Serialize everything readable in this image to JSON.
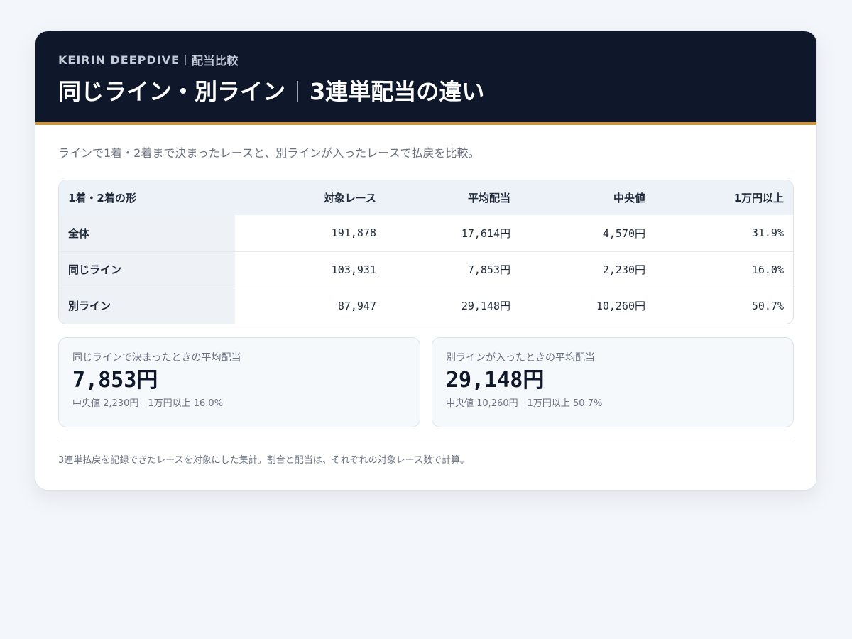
{
  "header": {
    "brand": "KEIRIN DEEPDIVE",
    "section": "配当比較",
    "title_left": "同じライン・別ライン",
    "title_right": "3連単配当の違い"
  },
  "colors": {
    "header_bg": "#0f172a",
    "accent": "#c9953f",
    "page_bg": "#f3f6fa"
  },
  "subtitle": "ラインで1着・2着まで決まったレースと、別ラインが入ったレースで払戻を比較。",
  "table": {
    "headers": [
      "1着・2着の形",
      "対象レース",
      "平均配当",
      "中央値",
      "1万円以上"
    ],
    "rows": [
      {
        "label": "全体",
        "races": "191,878",
        "avg": "17,614円",
        "median": "4,570円",
        "over10k": "31.9%"
      },
      {
        "label": "同じライン",
        "races": "103,931",
        "avg": "7,853円",
        "median": "2,230円",
        "over10k": "16.0%"
      },
      {
        "label": "別ライン",
        "races": "87,947",
        "avg": "29,148円",
        "median": "10,260円",
        "over10k": "50.7%"
      }
    ]
  },
  "stats": [
    {
      "label": "同じラインで決まったときの平均配当",
      "value": "7,853円",
      "meta_median": "中央値 2,230円",
      "meta_over": "1万円以上 16.0%"
    },
    {
      "label": "別ラインが入ったときの平均配当",
      "value": "29,148円",
      "meta_median": "中央値 10,260円",
      "meta_over": "1万円以上 50.7%"
    }
  ],
  "footnote": "3連単払戻を記録できたレースを対象にした集計。割合と配当は、それぞれの対象レース数で計算。"
}
